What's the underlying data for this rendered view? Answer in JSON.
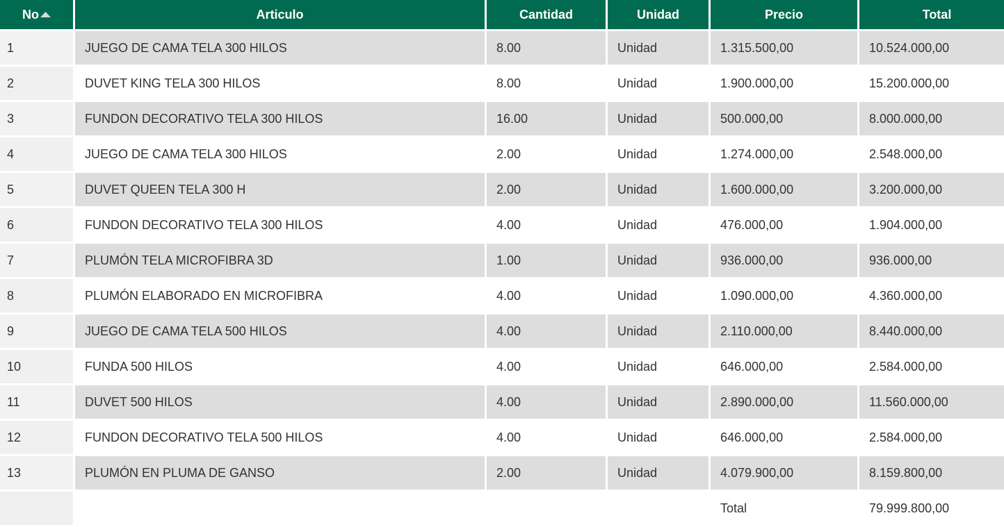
{
  "colors": {
    "header_bg": "#006b50",
    "header_text": "#ffffff",
    "row_shaded": "#dddddd",
    "row_plain": "#ffffff",
    "index_col_bg": "#f0f0f0"
  },
  "table": {
    "headers": {
      "no": "No",
      "articulo": "Articulo",
      "cantidad": "Cantidad",
      "unidad": "Unidad",
      "precio": "Precio",
      "total": "Total"
    },
    "sort_icon": "sort-ascending-icon",
    "rows": [
      {
        "no": "1",
        "articulo": "JUEGO DE CAMA TELA 300 HILOS",
        "cantidad": "8.00",
        "unidad": "Unidad",
        "precio": "1.315.500,00",
        "total": "10.524.000,00"
      },
      {
        "no": "2",
        "articulo": "DUVET KING TELA 300 HILOS",
        "cantidad": "8.00",
        "unidad": "Unidad",
        "precio": "1.900.000,00",
        "total": "15.200.000,00"
      },
      {
        "no": "3",
        "articulo": "FUNDON DECORATIVO TELA 300 HILOS",
        "cantidad": "16.00",
        "unidad": "Unidad",
        "precio": "500.000,00",
        "total": "8.000.000,00"
      },
      {
        "no": "4",
        "articulo": "JUEGO DE CAMA TELA 300 HILOS",
        "cantidad": "2.00",
        "unidad": "Unidad",
        "precio": "1.274.000,00",
        "total": "2.548.000,00"
      },
      {
        "no": "5",
        "articulo": "DUVET QUEEN TELA 300 H",
        "cantidad": "2.00",
        "unidad": "Unidad",
        "precio": "1.600.000,00",
        "total": "3.200.000,00"
      },
      {
        "no": "6",
        "articulo": "FUNDON DECORATIVO TELA 300 HILOS",
        "cantidad": "4.00",
        "unidad": "Unidad",
        "precio": "476.000,00",
        "total": "1.904.000,00"
      },
      {
        "no": "7",
        "articulo": "PLUMÓN TELA MICROFIBRA 3D",
        "cantidad": "1.00",
        "unidad": "Unidad",
        "precio": "936.000,00",
        "total": "936.000,00"
      },
      {
        "no": "8",
        "articulo": "PLUMÓN ELABORADO EN MICROFIBRA",
        "cantidad": "4.00",
        "unidad": "Unidad",
        "precio": "1.090.000,00",
        "total": "4.360.000,00"
      },
      {
        "no": "9",
        "articulo": "JUEGO DE CAMA TELA 500 HILOS",
        "cantidad": "4.00",
        "unidad": "Unidad",
        "precio": "2.110.000,00",
        "total": "8.440.000,00"
      },
      {
        "no": "10",
        "articulo": "FUNDA 500 HILOS",
        "cantidad": "4.00",
        "unidad": "Unidad",
        "precio": "646.000,00",
        "total": "2.584.000,00"
      },
      {
        "no": "11",
        "articulo": "DUVET 500 HILOS",
        "cantidad": "4.00",
        "unidad": "Unidad",
        "precio": "2.890.000,00",
        "total": "11.560.000,00"
      },
      {
        "no": "12",
        "articulo": "FUNDON DECORATIVO TELA 500 HILOS",
        "cantidad": "4.00",
        "unidad": "Unidad",
        "precio": "646.000,00",
        "total": "2.584.000,00"
      },
      {
        "no": "13",
        "articulo": "PLUMÓN EN PLUMA DE GANSO",
        "cantidad": "2.00",
        "unidad": "Unidad",
        "precio": "4.079.900,00",
        "total": "8.159.800,00"
      }
    ],
    "summary": {
      "label": "Total",
      "value": "79.999.800,00"
    }
  }
}
